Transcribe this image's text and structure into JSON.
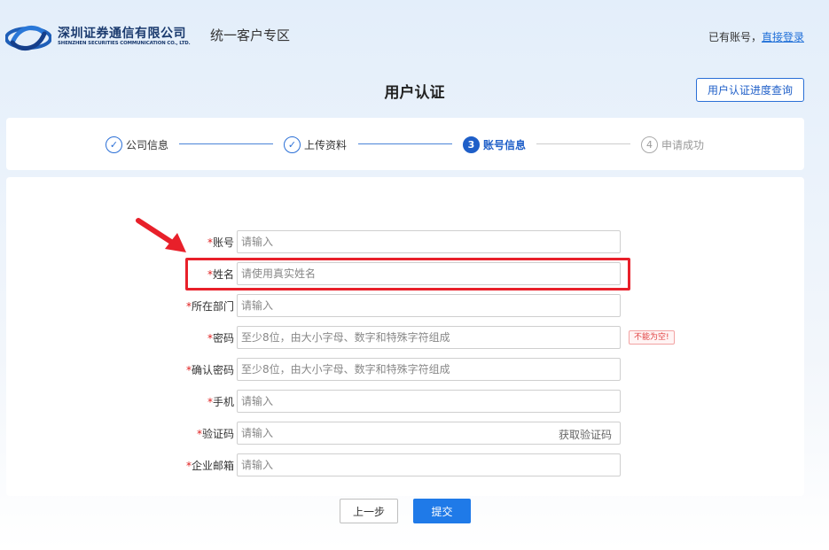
{
  "header": {
    "brand_cn": "深圳证券通信有限公司",
    "brand_en": "SHENZHEN SECURITIES COMMUNICATION CO., LTD.",
    "zone_title": "统一客户专区",
    "login_prefix": "已有账号，",
    "login_link": "直接登录"
  },
  "page": {
    "title": "用户认证",
    "progress_button": "用户认证进度查询"
  },
  "steps": [
    {
      "number": "✓",
      "label": "公司信息",
      "state": "done"
    },
    {
      "number": "✓",
      "label": "上传资料",
      "state": "done"
    },
    {
      "number": "3",
      "label": "账号信息",
      "state": "active"
    },
    {
      "number": "4",
      "label": "申请成功",
      "state": "todo"
    }
  ],
  "form": {
    "fields": [
      {
        "label": "账号",
        "placeholder": "请输入",
        "value": ""
      },
      {
        "label": "姓名",
        "placeholder": "请使用真实姓名",
        "value": ""
      },
      {
        "label": "所在部门",
        "placeholder": "请输入",
        "value": ""
      },
      {
        "label": "密码",
        "placeholder": "至少8位，由大小字母、数字和特殊字符组成",
        "value": "",
        "error": "不能为空!"
      },
      {
        "label": "确认密码",
        "placeholder": "至少8位，由大小字母、数字和特殊字符组成",
        "value": ""
      },
      {
        "label": "手机",
        "placeholder": "请输入",
        "value": ""
      },
      {
        "label": "验证码",
        "placeholder": "请输入",
        "value": "",
        "suffix": "获取验证码"
      },
      {
        "label": "企业邮箱",
        "placeholder": "请输入",
        "value": ""
      }
    ],
    "required_mark": "*"
  },
  "actions": {
    "prev": "上一步",
    "submit": "提交"
  },
  "colors": {
    "brand_blue": "#1f5fc8",
    "primary_button": "#1f7ae8",
    "annotation_red": "#e8202a",
    "required_red": "#e02020"
  },
  "annotations": {
    "arrow_icon": "red-arrow-icon",
    "highlight_target": "姓名"
  }
}
